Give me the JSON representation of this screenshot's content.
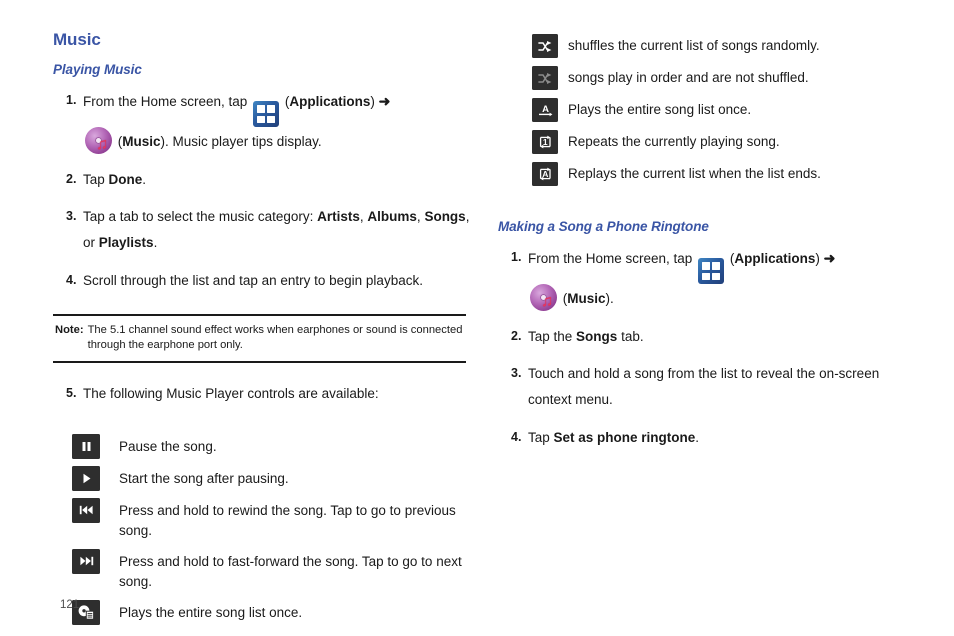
{
  "left_column": {
    "heading": "Music",
    "subheading": "Playing Music",
    "steps": [
      {
        "num": "1.",
        "text_before_apps": "From the Home screen, tap",
        "apps_icon": "applications-grid-icon",
        "apps_label_open": "(",
        "apps_label": "Applications",
        "apps_label_close": ")",
        "arrow": "➜",
        "music_icon": "music-disc-icon",
        "music_label_open": "(",
        "music_label": "Music",
        "music_label_close": "). Music player tips display."
      },
      {
        "num": "2.",
        "text_before": "Tap ",
        "bold": "Done",
        "text_after": "."
      },
      {
        "num": "3.",
        "text_before": "Tap a tab to select the music category: ",
        "b1": "Artists",
        "sep1": ", ",
        "b2": "Albums",
        "sep2": ", ",
        "b3": "Songs",
        "sep3": ", or ",
        "b4": "Playlists",
        "text_after": "."
      },
      {
        "num": "4.",
        "text": "Scroll through the list and tap an entry to begin playback."
      }
    ],
    "note": {
      "label": "Note:",
      "text": "The 5.1 channel sound effect works when earphones or sound is connected through the earphone port only."
    },
    "step5": {
      "num": "5.",
      "text": "The following Music Player controls are available:"
    },
    "controls": [
      {
        "icon": "pause-icon",
        "desc": "Pause the song."
      },
      {
        "icon": "play-icon",
        "desc": "Start the song after pausing."
      },
      {
        "icon": "rewind-icon",
        "desc": "Press and hold to rewind the song. Tap to go to previous song."
      },
      {
        "icon": "fast-forward-icon",
        "desc": "Press and hold to fast-forward  the song. Tap to go to next song."
      },
      {
        "icon": "play-list-once-icon",
        "desc": "Plays the entire song list once."
      }
    ]
  },
  "right_column": {
    "controls": [
      {
        "icon": "shuffle-on-icon",
        "desc": "shuffles the current list of songs randomly."
      },
      {
        "icon": "shuffle-off-icon",
        "desc": "songs play in order and are not shuffled."
      },
      {
        "icon": "play-all-once-icon",
        "desc": "Plays the entire song list once."
      },
      {
        "icon": "repeat-one-icon",
        "desc": "Repeats the currently playing song."
      },
      {
        "icon": "repeat-all-icon",
        "desc": "Replays the current list when the list ends."
      }
    ],
    "subheading": "Making a Song a Phone Ringtone",
    "steps": [
      {
        "num": "1.",
        "text_before_apps": "From the Home screen, tap",
        "apps_label_open": "(",
        "apps_label": "Applications",
        "apps_label_close": ")",
        "arrow": "➜",
        "music_label_open": "(",
        "music_label": "Music",
        "music_label_close": ")."
      },
      {
        "num": "2.",
        "text_before": "Tap the ",
        "bold": "Songs",
        "text_after": " tab."
      },
      {
        "num": "3.",
        "text": "Touch and hold a song from the list to reveal the on-screen context menu."
      },
      {
        "num": "4.",
        "text_before": "Tap ",
        "bold": "Set as phone ringtone",
        "text_after": "."
      }
    ]
  },
  "footer": {
    "page_number": "121"
  },
  "colors": {
    "heading_blue": "#3A55A5",
    "icon_tile": "#2e2e2e",
    "body_text": "#1a1a1a"
  }
}
